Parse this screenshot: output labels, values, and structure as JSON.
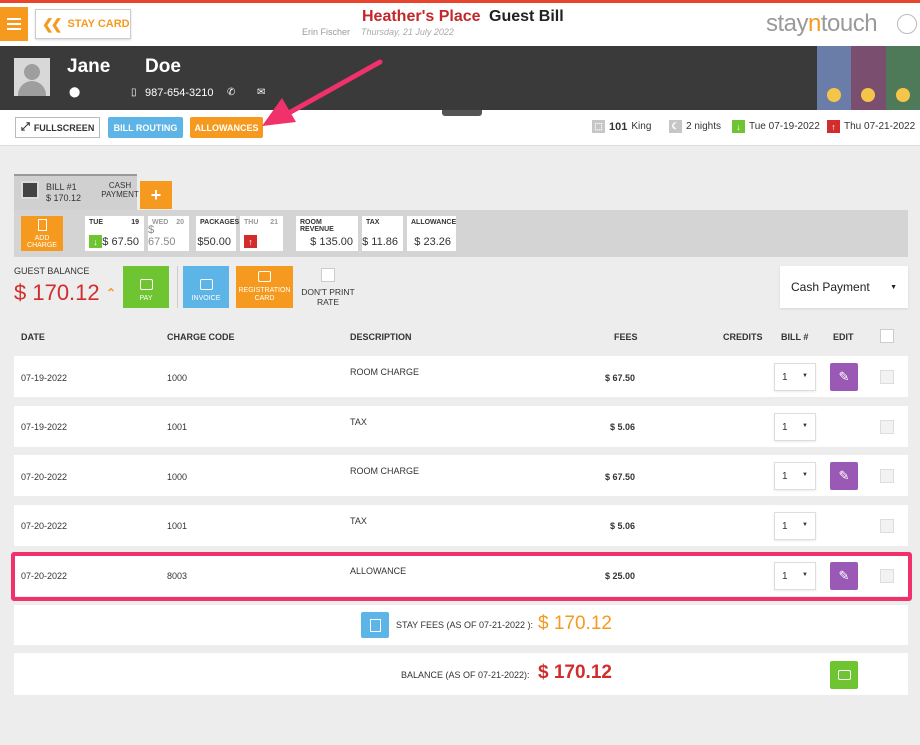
{
  "header": {
    "menu_icon": "hamburger-menu-icon",
    "stay_card_label": "STAY CARD",
    "hotel_name": "Heather's Place",
    "title": "Guest Bill",
    "user": "Erin Fischer",
    "date": "Thursday, 21 July 2022",
    "logo_pre": "stay",
    "logo_n": "n",
    "logo_post": "touch"
  },
  "guest": {
    "first_name": "Jane",
    "last_name": "Doe",
    "phone": "987-654-3210"
  },
  "toolbar": {
    "fullscreen": "FULLSCREEN",
    "bill_routing": "BILL ROUTING",
    "allowances": "ALLOWANCES",
    "room_number": "101",
    "room_type": "King",
    "nights": "2 nights",
    "arrival": "Tue 07-19-2022",
    "departure": "Thu 07-21-2022"
  },
  "bill_tab": {
    "name": "BILL #1",
    "amount": "$ 170.12",
    "payment_type": "CASH PAYMENT",
    "add_label": "+"
  },
  "summary": {
    "add_charge": "ADD CHARGE",
    "days": [
      {
        "dow": "TUE",
        "day": "19",
        "value": "$ 67.50"
      },
      {
        "dow": "WED",
        "day": "20",
        "value": "$ 67.50"
      },
      {
        "dow": "THU",
        "day": "21",
        "value": ""
      }
    ],
    "packages_label": "PACKAGES",
    "packages_value": "$50.00",
    "room_revenue_label": "ROOM REVENUE",
    "room_revenue_value": "$ 135.00",
    "tax_label": "TAX",
    "tax_value": "$ 11.86",
    "allowance_label": "ALLOWANCE",
    "allowance_value": "$ 23.26"
  },
  "balance": {
    "label": "GUEST BALANCE",
    "amount": "$ 170.12",
    "pay": "PAY",
    "invoice": "INVOICE",
    "registration_card": "REGISTRATION CARD",
    "dont_print_rate": "DON'T PRINT RATE",
    "payment_method": "Cash Payment"
  },
  "table": {
    "headers": {
      "date": "DATE",
      "charge_code": "CHARGE CODE",
      "description": "DESCRIPTION",
      "fees": "FEES",
      "credits": "CREDITS",
      "bill": "BILL #",
      "edit": "EDIT"
    },
    "rows": [
      {
        "date": "07-19-2022",
        "code": "1000",
        "description": "ROOM CHARGE",
        "fees": "$ 67.50",
        "bill": "1",
        "editable": true
      },
      {
        "date": "07-19-2022",
        "code": "1001",
        "description": "TAX",
        "fees": "$ 5.06",
        "bill": "1",
        "editable": false
      },
      {
        "date": "07-20-2022",
        "code": "1000",
        "description": "ROOM CHARGE",
        "fees": "$ 67.50",
        "bill": "1",
        "editable": true
      },
      {
        "date": "07-20-2022",
        "code": "1001",
        "description": "TAX",
        "fees": "$ 5.06",
        "bill": "1",
        "editable": false
      },
      {
        "date": "07-20-2022",
        "code": "8003",
        "description": "ALLOWANCE",
        "fees": "$ 25.00",
        "bill": "1",
        "editable": true
      }
    ]
  },
  "footer": {
    "stay_fees_label": "STAY FEES (AS OF  07-21-2022 ):",
    "stay_fees_amount": "$ 170.12",
    "balance_label": "BALANCE (AS OF  07-21-2022):",
    "balance_amount": "$ 170.12"
  },
  "colors": {
    "accent_orange": "#f59a1f",
    "brand_red": "#c0282a",
    "highlight_pink": "#f0316b",
    "edit_purple": "#9b59b6",
    "pay_green": "#6ec431",
    "info_blue": "#5db4e6"
  }
}
